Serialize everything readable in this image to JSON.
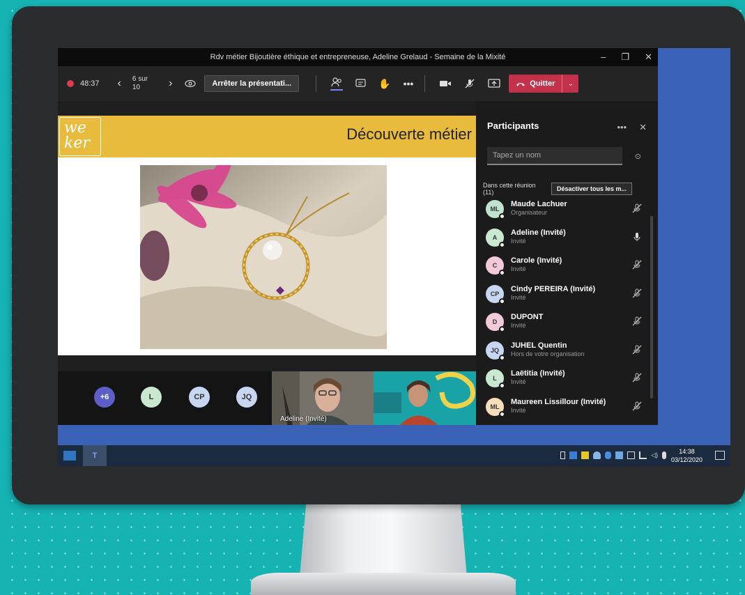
{
  "colors": {
    "accent_leave": "#c4314b",
    "slide_header": "#e9bb3d",
    "record": "#e03b4f",
    "taskbar": "#1b2a3e",
    "background": "#16b3b3"
  },
  "window": {
    "title": "Rdv métier Bijoutière éthique et entrepreneuse, Adeline Grelaud - Semaine de la Mixité"
  },
  "toolbar": {
    "timer": "48:37",
    "slide_counter_line1": "6 sur",
    "slide_counter_line2": "10",
    "stop_presenting": "Arrêter la présentati...",
    "leave_label": "Quitter"
  },
  "slide": {
    "logo_line1": "we",
    "logo_line2": "ker",
    "title": "Découverte métier"
  },
  "video_strip": {
    "avatars": [
      {
        "initials": "+6",
        "color": "#5b5fc7"
      },
      {
        "initials": "L",
        "color": "#c9e8d0"
      },
      {
        "initials": "CP",
        "color": "#c7d7f2"
      },
      {
        "initials": "JQ",
        "color": "#c7d7f2"
      }
    ],
    "tile_label": "Adeline (Invité)"
  },
  "panel": {
    "title": "Participants",
    "search_placeholder": "Tapez un nom",
    "section_line1": "Dans cette réunion",
    "section_line2": "(11)",
    "mute_all": "Désactiver tous les m...",
    "participants": [
      {
        "initials": "ML",
        "name": "Maude Lachuer",
        "role": "Organisateur",
        "color": "#bfe3cf",
        "mic": "muted"
      },
      {
        "initials": "A",
        "name": "Adeline (Invité)",
        "role": "Invité",
        "color": "#c9e8d0",
        "mic": "on"
      },
      {
        "initials": "C",
        "name": "Carole (Invité)",
        "role": "Invité",
        "color": "#f2c9d9",
        "mic": "muted"
      },
      {
        "initials": "CP",
        "name": "Cindy PEREIRA (Invité)",
        "role": "Invité",
        "color": "#c7d7f2",
        "mic": "muted"
      },
      {
        "initials": "D",
        "name": "DUPONT",
        "role": "Invité",
        "color": "#f2c9d9",
        "mic": "muted"
      },
      {
        "initials": "JQ",
        "name": "JUHEL Quentin",
        "role": "Hors de votre organisation",
        "color": "#c7d7f2",
        "mic": "muted"
      },
      {
        "initials": "L",
        "name": "Laëtitia (Invité)",
        "role": "Invité",
        "color": "#c9e8d0",
        "mic": "muted"
      },
      {
        "initials": "ML",
        "name": "Maureen Lissillour (Invité)",
        "role": "Invité",
        "color": "#f6dfb8",
        "mic": "muted"
      }
    ]
  },
  "taskbar": {
    "time": "14:38",
    "date": "03/12/2020"
  }
}
